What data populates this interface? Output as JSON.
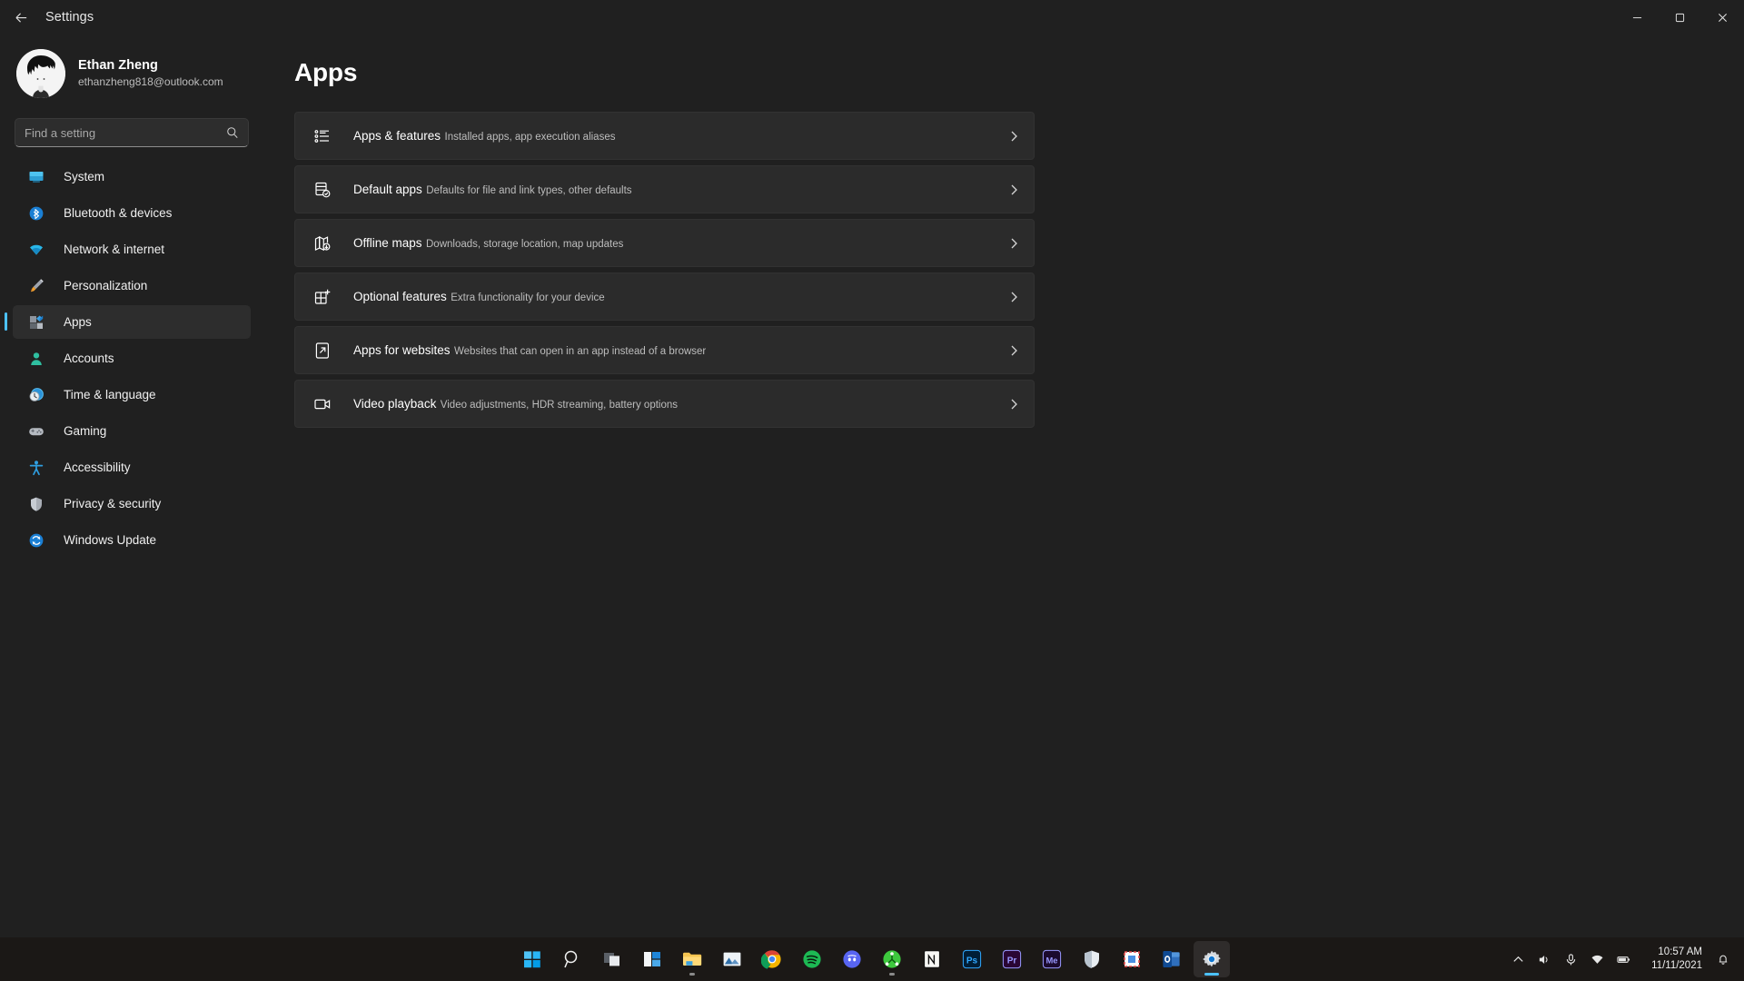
{
  "window": {
    "title": "Settings",
    "back_icon": "back-arrow-icon",
    "minimize_label": "Minimize",
    "maximize_label": "Maximize",
    "close_label": "Close"
  },
  "profile": {
    "name": "Ethan Zheng",
    "email": "ethanzheng818@outlook.com",
    "avatar_name": "user-avatar"
  },
  "search": {
    "placeholder": "Find a setting",
    "value": "",
    "icon": "search-icon"
  },
  "sidebar": {
    "items": [
      {
        "label": "System",
        "icon": "system-icon",
        "active": false
      },
      {
        "label": "Bluetooth & devices",
        "icon": "bluetooth-icon",
        "active": false
      },
      {
        "label": "Network & internet",
        "icon": "network-icon",
        "active": false
      },
      {
        "label": "Personalization",
        "icon": "personalization-icon",
        "active": false
      },
      {
        "label": "Apps",
        "icon": "apps-icon",
        "active": true
      },
      {
        "label": "Accounts",
        "icon": "accounts-icon",
        "active": false
      },
      {
        "label": "Time & language",
        "icon": "time-language-icon",
        "active": false
      },
      {
        "label": "Gaming",
        "icon": "gaming-icon",
        "active": false
      },
      {
        "label": "Accessibility",
        "icon": "accessibility-icon",
        "active": false
      },
      {
        "label": "Privacy & security",
        "icon": "privacy-security-icon",
        "active": false
      },
      {
        "label": "Windows Update",
        "icon": "windows-update-icon",
        "active": false
      }
    ]
  },
  "main": {
    "heading": "Apps",
    "cards": [
      {
        "title": "Apps & features",
        "subtitle": "Installed apps, app execution aliases",
        "icon": "apps-features-icon"
      },
      {
        "title": "Default apps",
        "subtitle": "Defaults for file and link types, other defaults",
        "icon": "default-apps-icon"
      },
      {
        "title": "Offline maps",
        "subtitle": "Downloads, storage location, map updates",
        "icon": "offline-maps-icon"
      },
      {
        "title": "Optional features",
        "subtitle": "Extra functionality for your device",
        "icon": "optional-features-icon"
      },
      {
        "title": "Apps for websites",
        "subtitle": "Websites that can open in an app instead of a browser",
        "icon": "apps-for-websites-icon"
      },
      {
        "title": "Video playback",
        "subtitle": "Video adjustments, HDR streaming, battery options",
        "icon": "video-playback-icon"
      }
    ]
  },
  "taskbar": {
    "items": [
      {
        "name": "start-button",
        "label": "Start",
        "running": false,
        "active": false
      },
      {
        "name": "search-taskbar-button",
        "label": "Search",
        "running": false,
        "active": false
      },
      {
        "name": "task-view-button",
        "label": "Task view",
        "running": false,
        "active": false
      },
      {
        "name": "widgets-button",
        "label": "Widgets",
        "running": false,
        "active": false
      },
      {
        "name": "file-explorer-button",
        "label": "File Explorer",
        "running": true,
        "active": false
      },
      {
        "name": "photos-button",
        "label": "Photos",
        "running": false,
        "active": false
      },
      {
        "name": "chrome-button",
        "label": "Google Chrome",
        "running": true,
        "active": false
      },
      {
        "name": "spotify-button",
        "label": "Spotify",
        "running": false,
        "active": false
      },
      {
        "name": "discord-button",
        "label": "Discord",
        "running": false,
        "active": false
      },
      {
        "name": "teamviewer-button",
        "label": "TeamViewer",
        "running": true,
        "active": false
      },
      {
        "name": "notion-button",
        "label": "Notion",
        "running": false,
        "active": false
      },
      {
        "name": "photoshop-button",
        "label": "Adobe Photoshop",
        "running": false,
        "active": false
      },
      {
        "name": "premiere-button",
        "label": "Adobe Premiere Pro",
        "running": false,
        "active": false
      },
      {
        "name": "media-encoder-button",
        "label": "Adobe Media Encoder",
        "running": false,
        "active": false
      },
      {
        "name": "bitdefender-button",
        "label": "Bitdefender",
        "running": false,
        "active": false
      },
      {
        "name": "snipping-tool-button",
        "label": "Snipping Tool",
        "running": false,
        "active": false
      },
      {
        "name": "outlook-button",
        "label": "Outlook",
        "running": false,
        "active": false
      },
      {
        "name": "settings-button",
        "label": "Settings",
        "running": true,
        "active": true
      }
    ],
    "tray": {
      "show_hidden_label": "Show hidden icons",
      "volume_label": "Volume",
      "mic_label": "Microphone",
      "network_label": "Network",
      "battery_label": "Battery",
      "time": "10:57 AM",
      "date": "11/11/2021",
      "notifications_label": "Notifications"
    }
  },
  "colors": {
    "accent": "#4cc2ff",
    "window_bg": "#202020",
    "card_bg": "#2b2b2b",
    "taskbar_bg": "#1b1816"
  }
}
